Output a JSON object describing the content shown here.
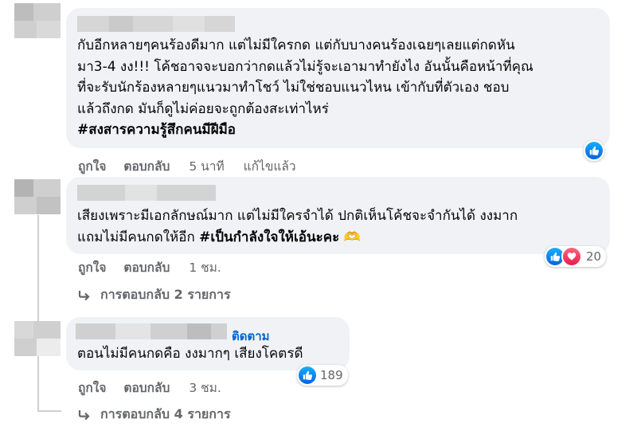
{
  "comments": [
    {
      "text": "กับอีกหลายๆคนร้องดีมาก แต่ไม่มีใครกด แต่กับบางคนร้องเฉยๆเลยแต่กดหัน\nมา3-4 งง!!! โค้ชอาจจะบอกว่ากดแล้วไม่รู้จะเอามาทำยังไง อันนั้นคือหน้าที่คุณ\nที่จะรับนักร้องหลายๆแนวมาทำโชว์ ไม่ใช่ชอบแนวไหน เข้ากับที่ตัวเอง ชอบ\nแล้วถึงกด มันก็ดูไม่ค่อยจะถูกต้องสะเท่าไหร่",
      "hashtag": "#สงสารความรู้สึกคนมีฝีมือ",
      "like": "ถูกใจ",
      "reply": "ตอบกลับ",
      "time": "5 นาที",
      "edited": "แก้ไขแล้ว",
      "reaction_icons": [
        "like-icon"
      ]
    },
    {
      "text": "เสียงเพราะมีเอกลักษณ์มาก แต่ไม่มีใครจำได้ ปกติเห็นโค้ชจะจำกันได้ งงมาก\nแถมไม่มีคนกดให้อีก ",
      "hashtag": "#เป็นกำลังใจให้เอ้นะคะ",
      "emoji": "🫶",
      "like": "ถูกใจ",
      "reply": "ตอบกลับ",
      "time": "1 ชม.",
      "reaction_icons": [
        "like-icon",
        "love-icon"
      ],
      "reaction_count": "20",
      "replies_label": "การตอบกลับ 2 รายการ"
    },
    {
      "follow_label": "ติดตาม",
      "text": "ตอนไม่มีคนกดคือ งงมากๆ เสียงโคตรดี",
      "like": "ถูกใจ",
      "reply": "ตอบกลับ",
      "time": "3 ชม.",
      "reaction_icons": [
        "like-icon"
      ],
      "reaction_count": "189",
      "replies_label": "การตอบกลับ 4 รายการ"
    }
  ],
  "colors": {
    "bubble": "#f0f2f5",
    "secondary_text": "#65676b",
    "link": "#0064d1",
    "like": "#0866ff",
    "love": "#f33e58"
  }
}
